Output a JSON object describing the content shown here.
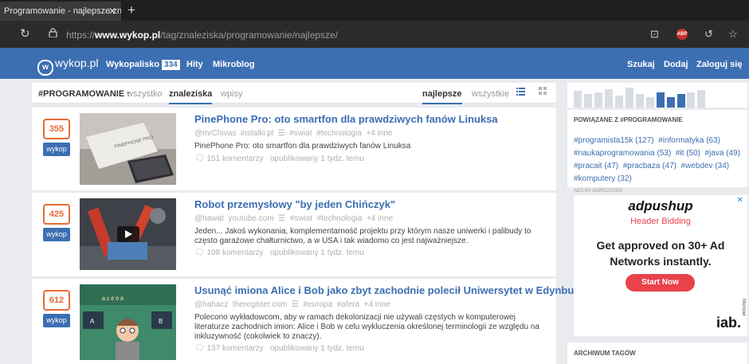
{
  "browser": {
    "tab_title": "Programowanie - najlepsze znal",
    "url_prefix": "https://",
    "url_domain": "www.wykop.pl",
    "url_path": "/tag/znaleziska/programowanie/najlepsze/"
  },
  "nav": {
    "logo": "wykop.pl",
    "wykopalisko": "Wykopalisko",
    "wykopalisko_count": "334",
    "hity": "Hity",
    "mikroblog": "Mikroblog",
    "szukaj": "Szukaj",
    "dodaj": "Dodaj",
    "zaloguj": "Zaloguj się"
  },
  "filters": {
    "tag": "#PROGRAMOWANIE :",
    "wszystko": "wszystko",
    "znaleziska": "znaleziska",
    "wpisy": "wpisy",
    "najlepsze": "najlepsze",
    "wszystkie": "wszystkie"
  },
  "entries": [
    {
      "votes": "355",
      "vote_label": "wykop",
      "title": "PinePhone Pro: oto smartfon dla prawdziwych fanów Linuksa",
      "author": "@mrChivas",
      "source": "instalki.pl",
      "tags": [
        "#swiat",
        "#technologia"
      ],
      "more": "+4 inne",
      "description": "PinePhone Pro: oto smartfon dla prawdziwych fanów Linuksa",
      "comments": "151 komentarzy",
      "published": "opublikowany 1 tydz. temu"
    },
    {
      "votes": "425",
      "vote_label": "wykop",
      "title": "Robot przemysłowy \"by jeden Chińczyk\"",
      "author": "@hawat",
      "source": "youtube.com",
      "tags": [
        "#swiat",
        "#technologia"
      ],
      "more": "+4 inne",
      "description": "Jeden... Jakoś wykonania, komplementarność projektu przy którym nasze uniwerki i palibudy to często garażowe chałturnictwo, a w USA i tak wiadomo co jest najważniejsze.",
      "comments": "108 komentarzy",
      "published": "opublikowany 1 tydz. temu"
    },
    {
      "votes": "612",
      "vote_label": "wykop",
      "title": "Usunąć imiona Alice i Bob jako zbyt zachodnie polecił Uniwersytet w Edynburgu.",
      "author": "@hahacz",
      "source": "theregister.com",
      "tags": [
        "#europa",
        "#afera"
      ],
      "more": "+4 inne",
      "description": "Polecono wykładowcom, aby w ramach dekolonizacji nie używali częstych w komputerowej literaturze zachodnich imion: Alice i Bob w celu wykluczenia określonej terminologii ze względu na inkluzywność (cokolwiek to znaczy).",
      "comments": "137 komentarzy",
      "published": "opublikowany 1 tydz. temu"
    }
  ],
  "sidebar": {
    "related_heading": "POWIĄZANE Z #PROGRAMOWANIE",
    "related_tags": [
      "#programista15k (127)",
      "#informatyka (63)",
      "#naukaprogramowania (53)",
      "#it (50)",
      "#java (49)",
      "#pracait (47)",
      "#pracbaza (47)",
      "#webdev (34)",
      "#komputery (32)"
    ],
    "ads_by": "ADS BY ADRECOVER",
    "archive_heading": "ARCHIWUM TAGÓW"
  },
  "ad": {
    "brand": "adpushup",
    "sub": "Header Bidding",
    "headline_1": "Get approved on 30+ Ad",
    "headline_2": "Networks instantly.",
    "cta": "Start Now",
    "iab": "iab.",
    "iab_member": "Member"
  },
  "colors": {
    "brand_blue": "#3c6eb2",
    "vote_orange": "#e86a38",
    "ad_red": "#e8424b"
  }
}
